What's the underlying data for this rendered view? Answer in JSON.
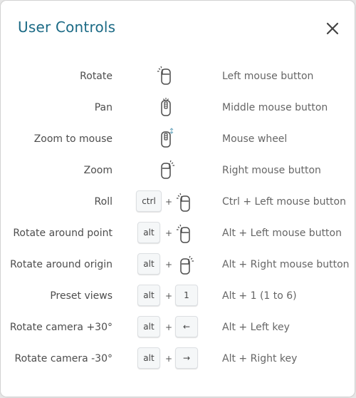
{
  "dialog": {
    "title": "User Controls",
    "close_icon": "close-icon"
  },
  "controls": [
    {
      "action": "Rotate",
      "keys": [],
      "mouse": "left",
      "description": "Left mouse button"
    },
    {
      "action": "Pan",
      "keys": [],
      "mouse": "middle",
      "description": "Middle mouse button"
    },
    {
      "action": "Zoom to mouse",
      "keys": [],
      "mouse": "wheel",
      "description": "Mouse wheel"
    },
    {
      "action": "Zoom",
      "keys": [],
      "mouse": "right",
      "description": "Right mouse button"
    },
    {
      "action": "Roll",
      "keys": [
        "ctrl"
      ],
      "mouse": "left",
      "description": "Ctrl + Left mouse button"
    },
    {
      "action": "Rotate around point",
      "keys": [
        "alt"
      ],
      "mouse": "left",
      "description": "Alt + Left mouse button"
    },
    {
      "action": "Rotate around origin",
      "keys": [
        "alt"
      ],
      "mouse": "right",
      "description": "Alt + Right mouse button"
    },
    {
      "action": "Preset views",
      "keys": [
        "alt",
        "1"
      ],
      "mouse": null,
      "description": "Alt + 1 (1 to 6)"
    },
    {
      "action": "Rotate camera +30°",
      "keys": [
        "alt",
        "←"
      ],
      "mouse": null,
      "description": "Alt + Left key"
    },
    {
      "action": "Rotate camera -30°",
      "keys": [
        "alt",
        "→"
      ],
      "mouse": null,
      "description": "Alt + Right key"
    }
  ],
  "plus_sign": "+",
  "colors": {
    "title": "#1b6a85",
    "wheel_arrow": "#6fa8bf"
  }
}
